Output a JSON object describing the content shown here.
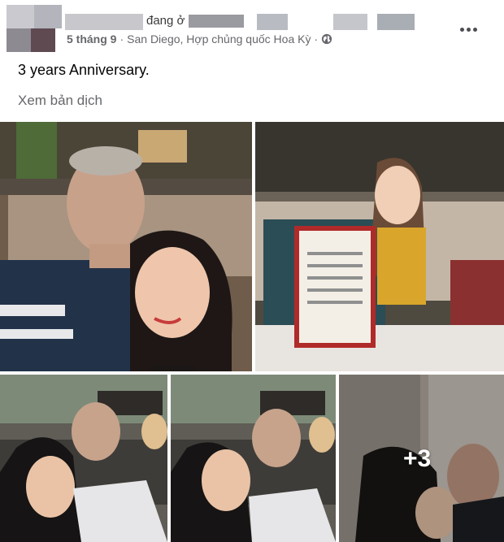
{
  "post": {
    "status_text": "đang ở",
    "date": "5 tháng 9",
    "separator": "·",
    "location": "San Diego, Hợp chủng quốc Hoa Kỳ",
    "location_separator": "·",
    "caption": "3 years Anniversary.",
    "translate_link": "Xem bản dịch",
    "more_photos_count": "+3"
  },
  "icons": {
    "more": "more-options-icon",
    "globe": "globe-icon"
  },
  "colors": {
    "text_primary": "#050505",
    "text_secondary": "#65676b",
    "background": "#ffffff"
  }
}
